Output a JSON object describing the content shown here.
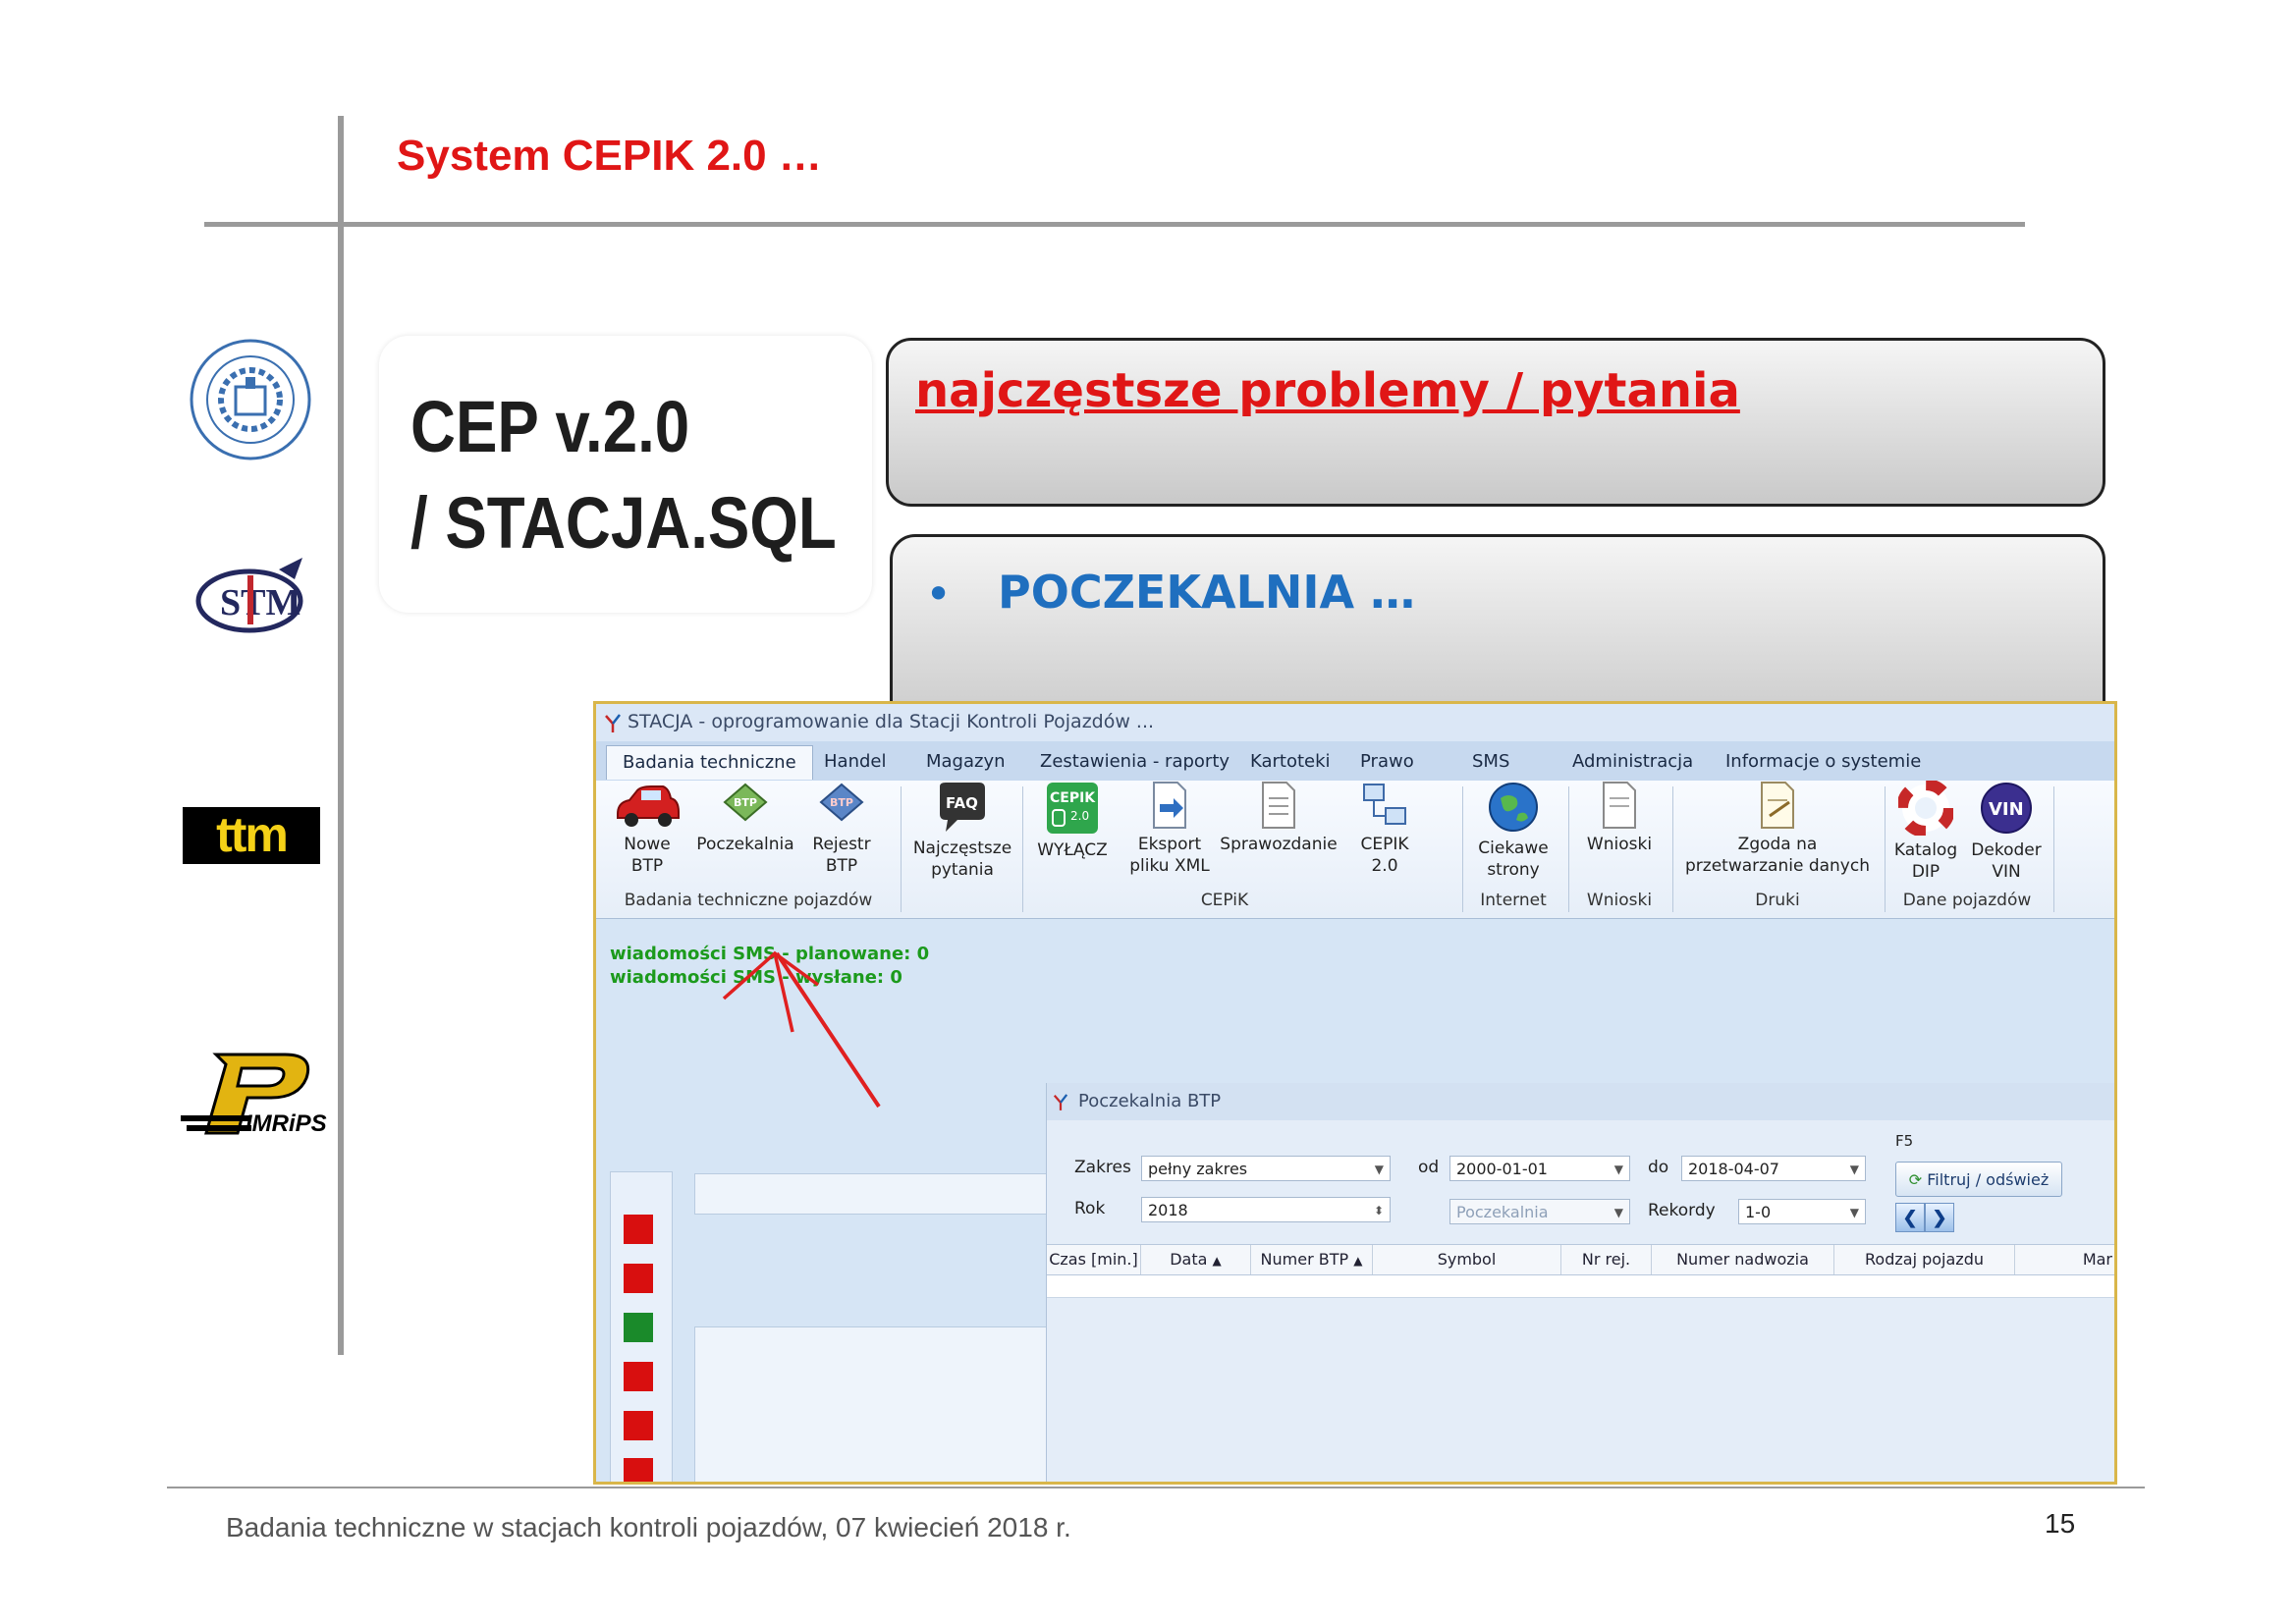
{
  "slide": {
    "title": "System CEPIK 2.0 …",
    "cep_line1": "CEP v.2.0",
    "cep_line2": "/ STACJA.SQL",
    "box1_text": "najczęstsze problemy / pytania",
    "box2_bullet": "•",
    "box2_text": "POCZEKALNIA …",
    "footer": "Badania techniczne w stacjach kontroli pojazdów, 07 kwiecień 2018 r.",
    "page_number": "15",
    "logo_ttm": "ttm",
    "logo_stm": "STM",
    "logo_imrips": "IMRiPS"
  },
  "app": {
    "title": "STACJA - oprogramowanie dla Stacji Kontroli Pojazdów ...",
    "tabs": [
      "Badania techniczne",
      "Handel",
      "Magazyn",
      "Zestawienia - raporty",
      "Kartoteki",
      "Prawo",
      "SMS",
      "Administracja",
      "Informacje o systemie"
    ],
    "ribbon": {
      "nowe_btp": [
        "Nowe",
        "BTP"
      ],
      "poczekalnia": "Poczekalnia",
      "rejestr_btp": [
        "Rejestr",
        "BTP"
      ],
      "najczestsze": [
        "Najczęstsze",
        "pytania"
      ],
      "wylacz": "WYŁĄCZ",
      "eksport": [
        "Eksport",
        "pliku XML"
      ],
      "sprawozdanie": "Sprawozdanie",
      "cepik20": [
        "CEPIK",
        "2.0"
      ],
      "ciekawe": [
        "Ciekawe",
        "strony"
      ],
      "wnioski": "Wnioski",
      "zgoda": [
        "Zgoda na",
        "przetwarzanie danych"
      ],
      "katalog": [
        "Katalog",
        "DIP"
      ],
      "dekoder": [
        "Dekoder",
        "VIN"
      ],
      "icon_labels": {
        "btp": "BTP",
        "faq": "FAQ",
        "cepik": "CEPIK",
        "cepik_ver": "2.0",
        "vin": "VIN"
      },
      "groups": {
        "badania": "Badania techniczne pojazdów",
        "cepik": "CEPiK",
        "internet": "Internet",
        "wnioski": "Wnioski",
        "druki": "Druki",
        "dane": "Dane pojazdów"
      }
    },
    "sms_planned": "wiadomości SMS - planowane: 0",
    "sms_sent": "wiadomości SMS - wysłane: 0",
    "queue_colors": [
      "#d80f0f",
      "#d80f0f",
      "#1a8a2a",
      "#d80f0f",
      "#d80f0f",
      "#d80f0f"
    ]
  },
  "subwindow": {
    "title": "Poczekalnia BTP",
    "zakres_label": "Zakres",
    "zakres_value": "pełny zakres",
    "od_label": "od",
    "od_value": "2000-01-01",
    "do_label": "do",
    "do_value": "2018-04-07",
    "f5_label": "F5",
    "filter_button": "Filtruj / odśwież",
    "rok_label": "Rok",
    "rok_value": "2018",
    "status_value": "Poczekalnia",
    "rekordy_label": "Rekordy",
    "rekordy_value": "1-0",
    "columns": [
      "Czas [min.]",
      "Data",
      "Numer BTP",
      "Symbol",
      "Nr rej.",
      "Numer nadwozia",
      "Rodzaj pojazdu",
      "Mar"
    ]
  }
}
